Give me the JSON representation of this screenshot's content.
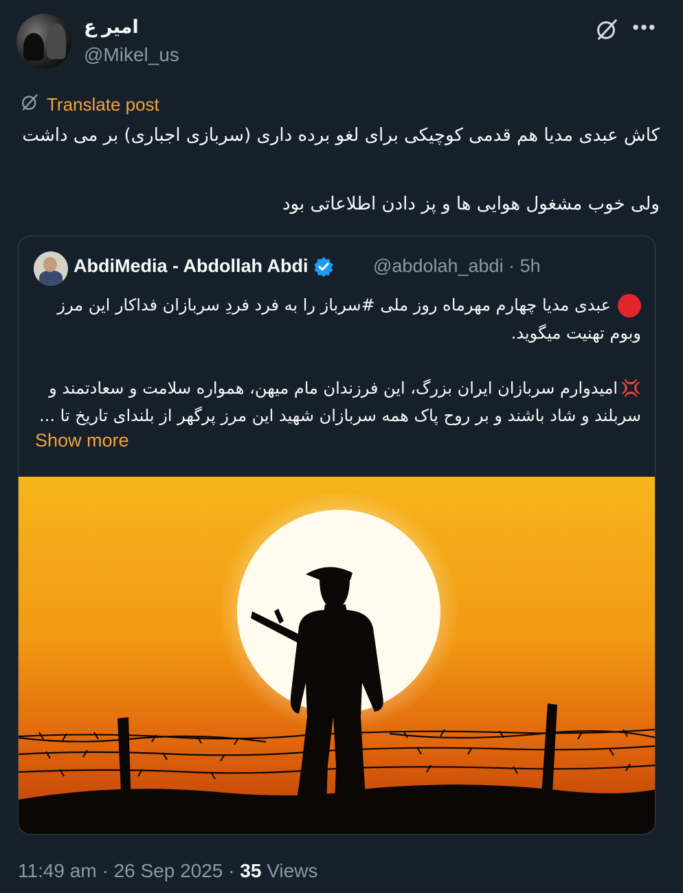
{
  "author": {
    "name": "امیر ع",
    "handle": "@Mikel_us"
  },
  "translate_label": "Translate post",
  "post_lines": [
    "کاش عبدی مدیا هم قدمی کوچیکی برای لغو برده داری  (سربازی اجباری) بر می داشت",
    "ولی خوب مشغول هوایی ها و پز دادن اطلاعاتی بود"
  ],
  "quoted": {
    "name": "AbdiMedia - Abdollah Abdi",
    "handle": "@abdolah_abdi",
    "separator": "·",
    "time": "5h",
    "line1": "عبدی مدیا چهارم مهرماه روز ملی #سرباز را به فرد فردِ سربازان فداکار این مرز",
    "line2": "وبوم تهنیت میگوید.",
    "line3": "امیدوارم سربازان ایران بزرگ، این فرزندان مام میهن، همواره سلامت و سعادتمند و",
    "line4": "سربلند و شاد باشند و بر روح پاک همه سربازان شهید این مرز پرگهر از بلندای تاریخ تا ...",
    "show_more": "Show more",
    "image_icon": "soldier-sunset-image"
  },
  "footer": {
    "time": "11:49 am",
    "sep1": " · ",
    "date": "26 Sep 2025",
    "sep2": " · ",
    "views_count": "35",
    "views_label": " Views"
  },
  "colors": {
    "background": "#15202b",
    "accent": "#f4a23d",
    "muted": "#8b98a5",
    "verified": "#1d9bf0"
  },
  "icons": [
    "grok-icon",
    "more-icon",
    "translate-icon",
    "verified-icon",
    "red-circle-icon",
    "anger-icon"
  ]
}
